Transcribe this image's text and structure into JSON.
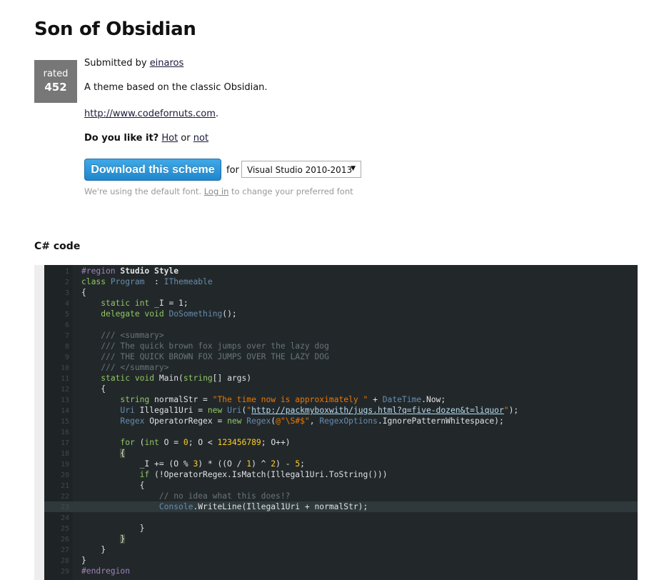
{
  "page_title": "Son of Obsidian",
  "rating": {
    "label": "rated",
    "value": "452"
  },
  "submitted_prefix": "Submitted by ",
  "author": "einaros",
  "description": "A theme based on the classic Obsidian.",
  "website": "http://www.codefornuts.com",
  "website_suffix": ".",
  "like_question": "Do you like it?",
  "hot_label": "Hot",
  "or_label": " or ",
  "not_label": "not",
  "download_label": "Download this scheme",
  "for_label": "for",
  "ide_select": {
    "selected": "Visual Studio 2010-2013",
    "arrow": "▼"
  },
  "font_note": {
    "before": "We're using the default font. ",
    "link": "Log in",
    "after": " to change your preferred font"
  },
  "section_title": "C# code",
  "colors": {
    "background": "#22282a",
    "keyword": "#93c763",
    "type": "#678cb1",
    "comment": "#66747b",
    "string": "#ec7600",
    "number": "#ffcd22",
    "text": "#e0e2e4",
    "button": "#2a96da"
  },
  "highlighted_line": 23,
  "code_lines": [
    [
      [
        "pp",
        "#region "
      ],
      [
        "id",
        "Studio Style"
      ]
    ],
    [
      [
        "kw",
        "class "
      ],
      [
        "ty",
        "Program"
      ],
      [
        "",
        "  : "
      ],
      [
        "ty",
        "IThemeable"
      ]
    ],
    [
      [
        "",
        "{"
      ]
    ],
    [
      [
        "",
        "    "
      ],
      [
        "kw",
        "static int "
      ],
      [
        "",
        "_I = 1;"
      ]
    ],
    [
      [
        "",
        "    "
      ],
      [
        "kw",
        "delegate void "
      ],
      [
        "ty",
        "DoSomething"
      ],
      [
        "",
        "();"
      ]
    ],
    [],
    [
      [
        "",
        "    "
      ],
      [
        "cm",
        "/// <summary>"
      ]
    ],
    [
      [
        "",
        "    "
      ],
      [
        "cm",
        "/// The quick brown fox jumps over the lazy dog"
      ]
    ],
    [
      [
        "",
        "    "
      ],
      [
        "cm",
        "/// THE QUICK BROWN FOX JUMPS OVER THE LAZY DOG"
      ]
    ],
    [
      [
        "",
        "    "
      ],
      [
        "cm",
        "/// </summary>"
      ]
    ],
    [
      [
        "",
        "    "
      ],
      [
        "kw",
        "static void "
      ],
      [
        "",
        "Main("
      ],
      [
        "kw",
        "string"
      ],
      [
        "",
        "[] args)"
      ]
    ],
    [
      [
        "",
        "    {"
      ]
    ],
    [
      [
        "",
        "        "
      ],
      [
        "kw",
        "string "
      ],
      [
        "",
        "normalStr = "
      ],
      [
        "st",
        "\"The time now is approximately \""
      ],
      [
        "",
        " + "
      ],
      [
        "ty",
        "DateTime"
      ],
      [
        "",
        ".Now;"
      ]
    ],
    [
      [
        "",
        "        "
      ],
      [
        "ty",
        "Uri "
      ],
      [
        "",
        "Illegal1Uri = "
      ],
      [
        "kw",
        "new "
      ],
      [
        "ty",
        "Uri"
      ],
      [
        "",
        "("
      ],
      [
        "st",
        "\""
      ],
      [
        "url",
        "http://packmyboxwith/jugs.html?q=five-dozen&t=liquor"
      ],
      [
        "st",
        "\""
      ],
      [
        "",
        ");"
      ]
    ],
    [
      [
        "",
        "        "
      ],
      [
        "ty",
        "Regex "
      ],
      [
        "",
        "OperatorRegex = "
      ],
      [
        "kw",
        "new "
      ],
      [
        "ty",
        "Regex"
      ],
      [
        "",
        "("
      ],
      [
        "st",
        "@\"\\S#$\""
      ],
      [
        "",
        ", "
      ],
      [
        "ty",
        "RegexOptions"
      ],
      [
        "",
        ".IgnorePatternWhitespace);"
      ]
    ],
    [],
    [
      [
        "",
        "        "
      ],
      [
        "kw",
        "for "
      ],
      [
        "",
        "("
      ],
      [
        "kw",
        "int "
      ],
      [
        "",
        "O = "
      ],
      [
        "nu",
        "0"
      ],
      [
        "",
        "; O < "
      ],
      [
        "nu",
        "123456789"
      ],
      [
        "",
        "; O++)"
      ]
    ],
    [
      [
        "",
        "        "
      ],
      [
        "br",
        "{"
      ]
    ],
    [
      [
        "",
        "            _I += (O % "
      ],
      [
        "nu",
        "3"
      ],
      [
        "",
        ") * ((O / "
      ],
      [
        "nu",
        "1"
      ],
      [
        "",
        ") ^ "
      ],
      [
        "nu",
        "2"
      ],
      [
        "",
        ") - "
      ],
      [
        "nu",
        "5"
      ],
      [
        "",
        ";"
      ]
    ],
    [
      [
        "",
        "            "
      ],
      [
        "kw",
        "if "
      ],
      [
        "",
        "(!OperatorRegex.IsMatch(Illegal1Uri.ToString()))"
      ]
    ],
    [
      [
        "",
        "            {"
      ]
    ],
    [
      [
        "",
        "                "
      ],
      [
        "cm",
        "// no idea what this does!?"
      ]
    ],
    [
      [
        "",
        "                "
      ],
      [
        "ty",
        "Console"
      ],
      [
        "",
        ".WriteLine(Illegal1Uri + normalStr);"
      ]
    ],
    [],
    [
      [
        "",
        "            }"
      ]
    ],
    [
      [
        "",
        "        "
      ],
      [
        "br",
        "}"
      ]
    ],
    [
      [
        "",
        "    }"
      ]
    ],
    [
      [
        "",
        "}"
      ]
    ],
    [
      [
        "pp",
        "#endregion"
      ]
    ]
  ]
}
